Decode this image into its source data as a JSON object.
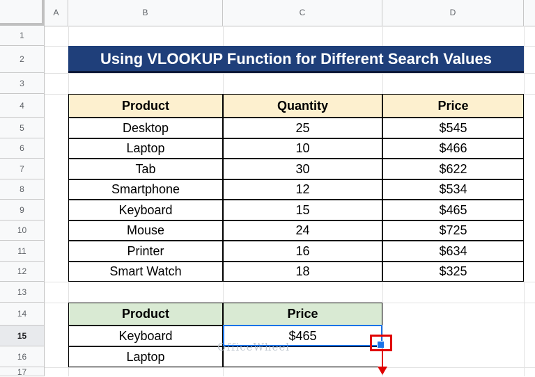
{
  "columns": [
    "A",
    "B",
    "C",
    "D"
  ],
  "rows": [
    "1",
    "2",
    "3",
    "4",
    "5",
    "6",
    "7",
    "8",
    "9",
    "10",
    "11",
    "12",
    "13",
    "14",
    "15",
    "16",
    "17"
  ],
  "selected_row": "15",
  "title": "Using VLOOKUP Function for Different Search Values",
  "table1": {
    "headers": [
      "Product",
      "Quantity",
      "Price"
    ],
    "rows": [
      [
        "Desktop",
        "25",
        "$545"
      ],
      [
        "Laptop",
        "10",
        "$466"
      ],
      [
        "Tab",
        "30",
        "$622"
      ],
      [
        "Smartphone",
        "12",
        "$534"
      ],
      [
        "Keyboard",
        "15",
        "$465"
      ],
      [
        "Mouse",
        "24",
        "$725"
      ],
      [
        "Printer",
        "16",
        "$634"
      ],
      [
        "Smart Watch",
        "18",
        "$325"
      ]
    ]
  },
  "table2": {
    "headers": [
      "Product",
      "Price"
    ],
    "rows": [
      [
        "Keyboard",
        "$465"
      ],
      [
        "Laptop",
        ""
      ]
    ]
  },
  "watermark": "OfficeWheel",
  "colors": {
    "title_bg": "#1f3f7a",
    "header1_bg": "#fdf0cf",
    "header2_bg": "#d9ead3",
    "selection": "#1a73e8",
    "annotation": "#e00000"
  }
}
